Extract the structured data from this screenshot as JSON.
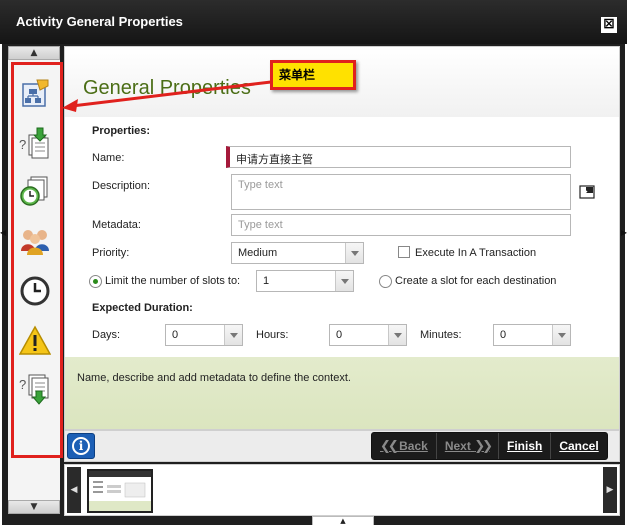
{
  "window": {
    "title": "Activity General Properties",
    "close_glyph": "⊠"
  },
  "sidebar": {
    "scroll_up": "▲",
    "scroll_down": "▼",
    "items": [
      {
        "icon": "activity-settings-icon"
      },
      {
        "icon": "client-event-import-icon"
      },
      {
        "icon": "timed-events-icon"
      },
      {
        "icon": "destination-users-icon"
      },
      {
        "icon": "deadline-clock-icon"
      },
      {
        "icon": "warning-icon"
      },
      {
        "icon": "data-export-icon"
      }
    ]
  },
  "annotation": {
    "label": "菜单栏"
  },
  "form": {
    "page_title": "General Properties",
    "properties_heading": "Properties:",
    "name_label": "Name:",
    "name_value": "申请方直接主管",
    "description_label": "Description:",
    "description_placeholder": "Type text",
    "metadata_label": "Metadata:",
    "metadata_placeholder": "Type text",
    "priority_label": "Priority:",
    "priority_value": "Medium",
    "transaction_label": "Execute In A Transaction",
    "transaction_checked": false,
    "limit_slots_label": "Limit the number of slots to:",
    "limit_slots_selected": true,
    "slots_value": "1",
    "slot_per_destination_label": "Create a slot for each destination",
    "slot_per_destination_selected": false,
    "expected_duration_heading": "Expected Duration:",
    "days_label": "Days:",
    "days_value": "0",
    "hours_label": "Hours:",
    "hours_value": "0",
    "minutes_label": "Minutes:",
    "minutes_value": "0"
  },
  "help": {
    "text": "Name, describe and add metadata to define the context."
  },
  "buttons": {
    "info_glyph": "i",
    "back_label": "Back",
    "next_label": "Next",
    "finish_label": "Finish",
    "cancel_label": "Cancel"
  },
  "thumbnails": {
    "left_arrow": "◀",
    "right_arrow": "▶"
  },
  "colors": {
    "title_bar": "#1f1f1f",
    "page_title": "#4b6e16",
    "help_band": "#dfe8c6",
    "highlight": "#e0211d",
    "callout_fill": "#ffe100"
  }
}
